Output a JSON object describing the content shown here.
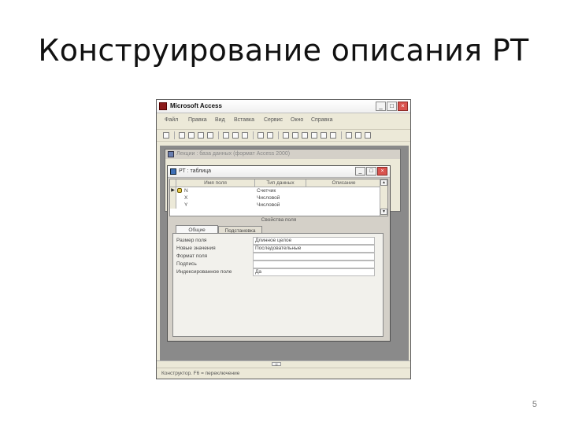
{
  "slide": {
    "title": "Конструирование описания РТ",
    "page_number": "5"
  },
  "app": {
    "title": "Microsoft Access",
    "window_buttons": {
      "minimize": "_",
      "maximize": "□",
      "close": "×"
    },
    "menu": [
      "Файл",
      "Правка",
      "Вид",
      "Вставка",
      "Сервис",
      "Окно",
      "Справка"
    ],
    "help_box": "?"
  },
  "db_window": {
    "title": "Лекции : база данных (формат Access 2000)"
  },
  "table_window": {
    "title": "РТ : таблица",
    "columns": [
      "Имя поля",
      "Тип данных",
      "Описание"
    ],
    "rows": [
      {
        "field": "N",
        "type": "Счетчик",
        "key": true
      },
      {
        "field": "X",
        "type": "Числовой",
        "key": false
      },
      {
        "field": "Y",
        "type": "Числовой",
        "key": false
      }
    ],
    "properties_label": "Свойства поля",
    "tabs": [
      "Общие",
      "Подстановка"
    ],
    "properties": [
      {
        "name": "Размер поля",
        "value": "Длинное целое"
      },
      {
        "name": "Новые значения",
        "value": "Последовательные"
      },
      {
        "name": "Формат поля",
        "value": ""
      },
      {
        "name": "Подпись",
        "value": ""
      },
      {
        "name": "Индексированное поле",
        "value": "Да"
      }
    ]
  },
  "statusbar": {
    "text": "Конструктор. F6 = переключение"
  }
}
